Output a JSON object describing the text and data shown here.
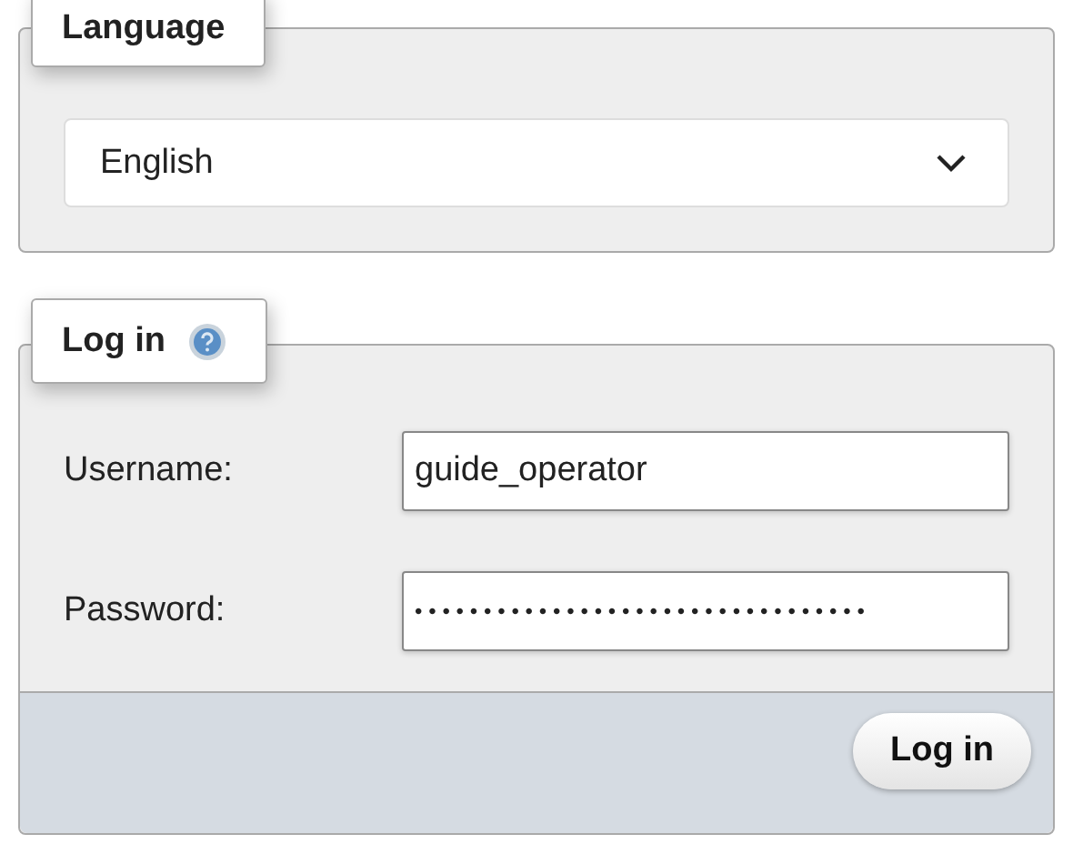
{
  "language": {
    "legend": "Language",
    "select": {
      "value": "English"
    }
  },
  "login": {
    "legend": "Log in",
    "fields": [
      {
        "label": "Username:",
        "value": "guide_operator",
        "kind": "text"
      },
      {
        "label": "Password:",
        "value": "•••••••••••••••••••••••••••••••••",
        "kind": "password"
      }
    ],
    "submit": "Log in"
  }
}
